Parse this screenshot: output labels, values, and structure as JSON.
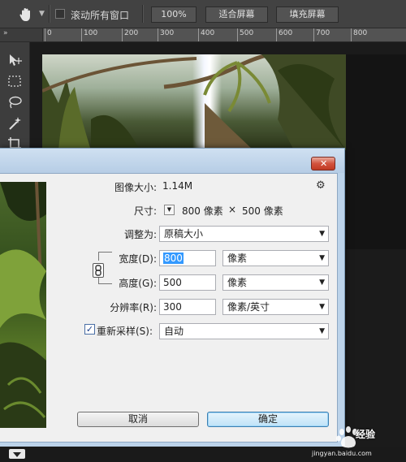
{
  "optionsbar": {
    "scroll_all_label": "滚动所有窗口",
    "zoom_100": "100%",
    "fit_screen": "适合屏幕",
    "fill_screen": "填充屏幕"
  },
  "ruler": {
    "ticks": [
      "0",
      "100",
      "200",
      "300",
      "400",
      "500",
      "600",
      "700",
      "800"
    ]
  },
  "dialog": {
    "image_size_label": "图像大小:",
    "image_size_value": "1.14M",
    "dimensions_label": "尺寸:",
    "dim_width": "800 像素",
    "dim_x": "×",
    "dim_height": "500 像素",
    "fit_to_label": "调整为:",
    "fit_to_value": "原稿大小",
    "width_label": "宽度(D):",
    "width_value": "800",
    "width_unit": "像素",
    "height_label": "高度(G):",
    "height_value": "500",
    "height_unit": "像素",
    "resolution_label": "分辨率(R):",
    "resolution_value": "300",
    "resolution_unit": "像素/英寸",
    "resample_label": "重新采样(S):",
    "resample_checked": true,
    "resample_value": "自动",
    "cancel_label": "取消",
    "ok_label": "确定"
  },
  "watermark": {
    "text": "经验",
    "url": "jingyan.baidu.com"
  },
  "colors": {
    "ps_dark": "#424242",
    "dialog_frame": "#bcd3ea",
    "close_red": "#c13a22",
    "selection": "#3399ff",
    "ok_border": "#3c7fb1"
  }
}
